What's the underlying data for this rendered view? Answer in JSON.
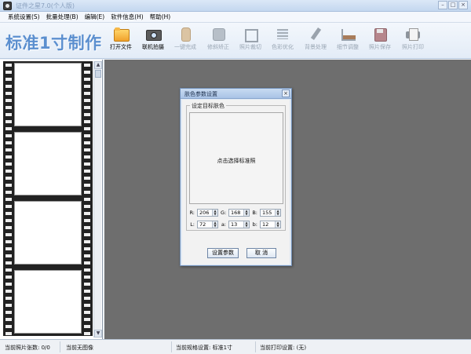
{
  "window": {
    "title": "证件之星7.0(个人版)",
    "btn_min": "–",
    "btn_max": "□",
    "btn_close": "×"
  },
  "menu": [
    "系统设置(S)",
    "批量处理(B)",
    "编辑(E)",
    "软件信息(H)",
    "帮助(H)"
  ],
  "toolbar": {
    "brand": "标准1寸制作",
    "tools": [
      {
        "label": "打开文件",
        "icon": "folder-icon",
        "enabled": true
      },
      {
        "label": "联机拍摄",
        "icon": "camera-icon",
        "enabled": true
      },
      {
        "label": "一键完成",
        "icon": "hand-icon",
        "enabled": false
      },
      {
        "label": "修斜矫正",
        "icon": "rotate-icon",
        "enabled": false
      },
      {
        "label": "照片裁切",
        "icon": "crop-icon",
        "enabled": false
      },
      {
        "label": "色彩优化",
        "icon": "color-bars-icon",
        "enabled": false
      },
      {
        "label": "背景处理",
        "icon": "brush-icon",
        "enabled": false
      },
      {
        "label": "细节调整",
        "icon": "chart-icon",
        "enabled": false
      },
      {
        "label": "照片保存",
        "icon": "disk-icon",
        "enabled": false
      },
      {
        "label": "照片打印",
        "icon": "printer-icon",
        "enabled": false
      }
    ]
  },
  "dialog": {
    "title": "肤色参数设置",
    "close": "×",
    "group_title": "设定目标肤色",
    "preview_text": "点击选择标准照",
    "fields": {
      "R": {
        "label": "R:",
        "value": "206"
      },
      "G": {
        "label": "G:",
        "value": "168"
      },
      "B": {
        "label": "B:",
        "value": "155"
      },
      "L": {
        "label": "L:",
        "value": "72"
      },
      "a": {
        "label": "a:",
        "value": "13"
      },
      "b": {
        "label": "b:",
        "value": "12"
      }
    },
    "ok_label": "设置参数",
    "cancel_label": "取  消"
  },
  "status": {
    "photo_count": "当前照片张数: 0/0",
    "current_image": "当前无图像",
    "spec": "当前规格设置:  标准1寸",
    "print": "当前打印设置:  (无)"
  },
  "colors": {
    "brand": "#5b8fcf",
    "workspace_bg": "#6e6e6e",
    "dialog_border": "#6f8db5"
  }
}
